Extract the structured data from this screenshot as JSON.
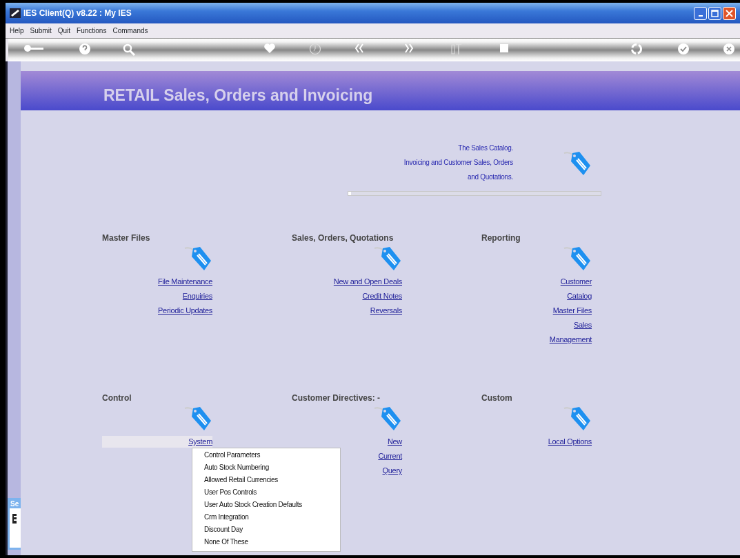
{
  "window": {
    "title": "IES Client(Q) v8.22 : My IES"
  },
  "menu": [
    "Help",
    "Submit",
    "Quit",
    "Functions",
    "Commands"
  ],
  "header": {
    "title": "RETAIL Sales, Orders and Invoicing"
  },
  "description": [
    "The Sales Catalog.",
    "Invoicing and Customer Sales, Orders",
    "and Quotations."
  ],
  "progress": {
    "level": 0.01
  },
  "sections": [
    {
      "title": "Master Files",
      "links": [
        {
          "label": "File Maintenance",
          "selected": false
        },
        {
          "label": "Enquiries",
          "selected": false
        },
        {
          "label": "Periodic Updates",
          "selected": false
        }
      ]
    },
    {
      "title": "Sales, Orders, Quotations",
      "links": [
        {
          "label": "New and Open Deals",
          "selected": false
        },
        {
          "label": "Credit Notes",
          "selected": false
        },
        {
          "label": "Reversals",
          "selected": false
        }
      ]
    },
    {
      "title": "Reporting",
      "links": [
        {
          "label": "Customer",
          "selected": false
        },
        {
          "label": "Catalog",
          "selected": false
        },
        {
          "label": "Master Files",
          "selected": false
        },
        {
          "label": "Sales",
          "selected": false
        },
        {
          "label": "Management",
          "selected": false
        }
      ]
    },
    {
      "title": "Control",
      "links": [
        {
          "label": "System",
          "selected": true
        }
      ]
    },
    {
      "title": "Customer Directives: -",
      "links": [
        {
          "label": "New",
          "selected": false
        },
        {
          "label": "Current",
          "selected": false
        },
        {
          "label": "Query",
          "selected": false
        }
      ]
    },
    {
      "title": "Custom",
      "links": [
        {
          "label": "Local Options",
          "selected": false
        }
      ]
    }
  ],
  "popup_menu": [
    "Control Parameters",
    "Auto Stock Numbering",
    "Allowed Retail Currencies",
    "User Pos Controls",
    "User Auto Stock Creation Defaults",
    "Crm Integration",
    "Discount Day",
    "None Of These"
  ],
  "side_panel": {
    "title": "Se"
  }
}
